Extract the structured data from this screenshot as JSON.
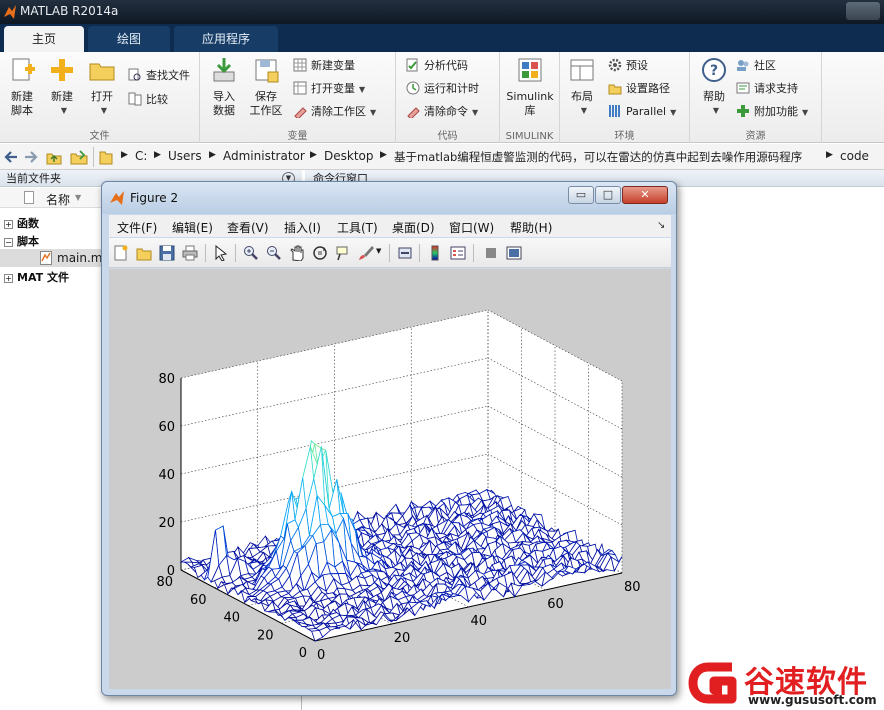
{
  "window": {
    "title": "MATLAB R2014a"
  },
  "tabs": [
    {
      "label": "主页",
      "active": true
    },
    {
      "label": "绘图",
      "active": false
    },
    {
      "label": "应用程序",
      "active": false
    }
  ],
  "ribbon": {
    "file_group": {
      "caption": "文件",
      "new_script": [
        "新建",
        "脚本"
      ],
      "new": "新建",
      "open": "打开",
      "find_files": "查找文件",
      "compare": "比较"
    },
    "variable_group": {
      "caption": "变量",
      "import_data": [
        "导入",
        "数据"
      ],
      "save_workspace": [
        "保存",
        "工作区"
      ],
      "new_variable": "新建变量",
      "open_variable": "打开变量",
      "clear_workspace": "清除工作区"
    },
    "code_group": {
      "caption": "代码",
      "analyze_code": "分析代码",
      "run_and_time": "运行和计时",
      "clear_commands": "清除命令"
    },
    "simulink_group": {
      "caption": "SIMULINK",
      "library": [
        "Simulink",
        "库"
      ]
    },
    "environment_group": {
      "caption": "环境",
      "layout": "布局",
      "preferences": "预设",
      "set_path": "设置路径",
      "parallel": "Parallel"
    },
    "resources_group": {
      "caption": "资源",
      "help": "帮助",
      "community": "社区",
      "request_support": "请求支持",
      "add_ons": "附加功能"
    }
  },
  "address_bar": {
    "path": [
      "C:",
      "Users",
      "Administrator",
      "Desktop",
      "基于matlab编程恒虚警监测的代码，可以在雷达的仿真中起到去噪作用源码程序",
      "code"
    ]
  },
  "current_folder": {
    "title": "当前文件夹",
    "column_name": "名称",
    "nodes": [
      {
        "label": "函数",
        "expanded": false
      },
      {
        "label": "脚本",
        "expanded": true
      },
      {
        "label": "main.m"
      },
      {
        "label": "MAT 文件",
        "expanded": false
      }
    ]
  },
  "command_window": {
    "title": "命令行窗口"
  },
  "figure": {
    "title": "Figure 2",
    "menu": [
      "文件(F)",
      "编辑(E)",
      "查看(V)",
      "插入(I)",
      "工具(T)",
      "桌面(D)",
      "窗口(W)",
      "帮助(H)"
    ],
    "window_buttons": {
      "minimize": "▭",
      "maximize": "□",
      "close": "✕"
    }
  },
  "chart_data": {
    "type": "mesh",
    "z_ticks": [
      "0",
      "20",
      "40",
      "60",
      "80"
    ],
    "x_ticks": [
      "0",
      "20",
      "40",
      "60",
      "80"
    ],
    "y_ticks": [
      "0",
      "20",
      "40",
      "60",
      "80"
    ],
    "zlim": [
      0,
      80
    ],
    "xlim": [
      0,
      80
    ],
    "ylim": [
      0,
      80
    ],
    "grid": true,
    "colormap": "jet",
    "noise_floor_max": 8,
    "peaks": [
      {
        "x": 20,
        "y": 45,
        "height": 65
      },
      {
        "x": 3,
        "y": 64,
        "height": 27
      },
      {
        "x": 7,
        "y": 61,
        "height": 15
      }
    ]
  },
  "watermark": {
    "name": "谷速软件",
    "url": "www.gususoft.com",
    "color": "#e11f20"
  }
}
